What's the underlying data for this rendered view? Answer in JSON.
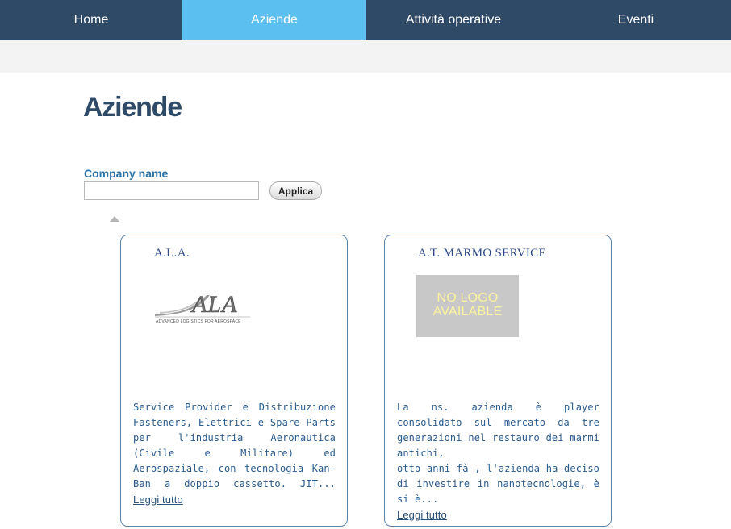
{
  "nav": {
    "items": [
      {
        "label": "Home"
      },
      {
        "label": "Aziende"
      },
      {
        "label": "Attività operative"
      },
      {
        "label": "Eventi"
      }
    ]
  },
  "page": {
    "title": "Aziende"
  },
  "filter": {
    "label": "Company name",
    "value": "",
    "button_label": "Applica"
  },
  "companies": [
    {
      "name": "A.L.A.",
      "logo_text": "ALA",
      "logo_subtext": "ADVANCED LOGISTICS FOR AEROSPACE",
      "description": "Service Provider e Distribuzione Fasteners, Elettrici e Spare Parts per l'industria Aeronautica (Civile e Militare) ed Aerospaziale, con tecnologia Kan-Ban a doppio cassetto. JIT...",
      "read_more": "Leggi tutto"
    },
    {
      "name": "A.T. MARMO SERVICE",
      "no_logo_text": "NO LOGO AVAILABLE",
      "description_lines": [
        "La ns. azienda è player consolidato sul mercato da tre generazioni nel restauro dei marmi antichi,",
        "otto anni fà , l'azienda ha deciso di investire in nanotecnologie, è si è..."
      ],
      "read_more": "Leggi tutto"
    }
  ]
}
